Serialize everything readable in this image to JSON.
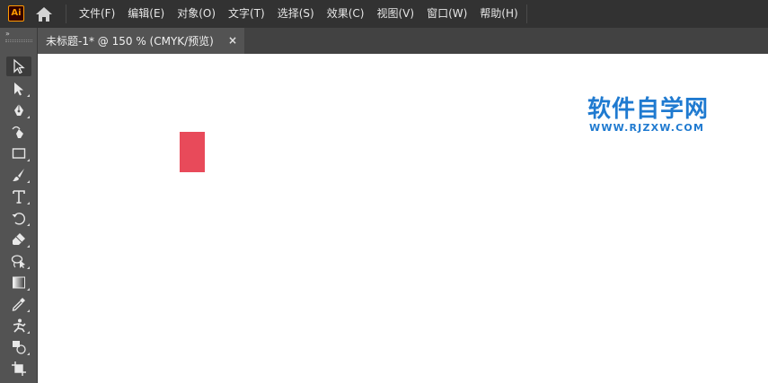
{
  "app": {
    "logo_text": "Ai",
    "accent": "#ff9a00"
  },
  "menu": {
    "items": [
      {
        "label": "文件(F)"
      },
      {
        "label": "编辑(E)"
      },
      {
        "label": "对象(O)"
      },
      {
        "label": "文字(T)"
      },
      {
        "label": "选择(S)"
      },
      {
        "label": "效果(C)"
      },
      {
        "label": "视图(V)"
      },
      {
        "label": "窗口(W)"
      },
      {
        "label": "帮助(H)"
      }
    ]
  },
  "toolbar": {
    "collapse_glyph": "»",
    "tools": [
      {
        "name": "selection-tool",
        "icon": "arrow-icon",
        "active": true
      },
      {
        "name": "direct-selection-tool",
        "icon": "direct-arrow-icon"
      },
      {
        "name": "pen-tool",
        "icon": "pen-icon"
      },
      {
        "name": "curvature-tool",
        "icon": "curvature-icon"
      },
      {
        "name": "rectangle-tool",
        "icon": "rectangle-icon"
      },
      {
        "name": "paintbrush-tool",
        "icon": "brush-icon"
      },
      {
        "name": "type-tool",
        "icon": "type-icon"
      },
      {
        "name": "rotate-tool",
        "icon": "rotate-icon"
      },
      {
        "name": "eraser-tool",
        "icon": "eraser-icon"
      },
      {
        "name": "lasso-tool",
        "icon": "lasso-icon"
      },
      {
        "name": "gradient-tool",
        "icon": "gradient-icon"
      },
      {
        "name": "eyedropper-tool",
        "icon": "eyedropper-icon"
      },
      {
        "name": "puppet-warp-tool",
        "icon": "puppet-icon"
      },
      {
        "name": "shape-builder-tool",
        "icon": "shape-builder-icon"
      },
      {
        "name": "artboard-tool",
        "icon": "artboard-icon"
      }
    ]
  },
  "document": {
    "tab_label": "未标题-1* @ 150 % (CMYK/预览)",
    "close_glyph": "×"
  },
  "canvas": {
    "shape_color": "#e84a5a",
    "watermark_title": "软件自学网",
    "watermark_url": "WWW.RJZXW.COM",
    "watermark_color": "#1f7ad0"
  }
}
